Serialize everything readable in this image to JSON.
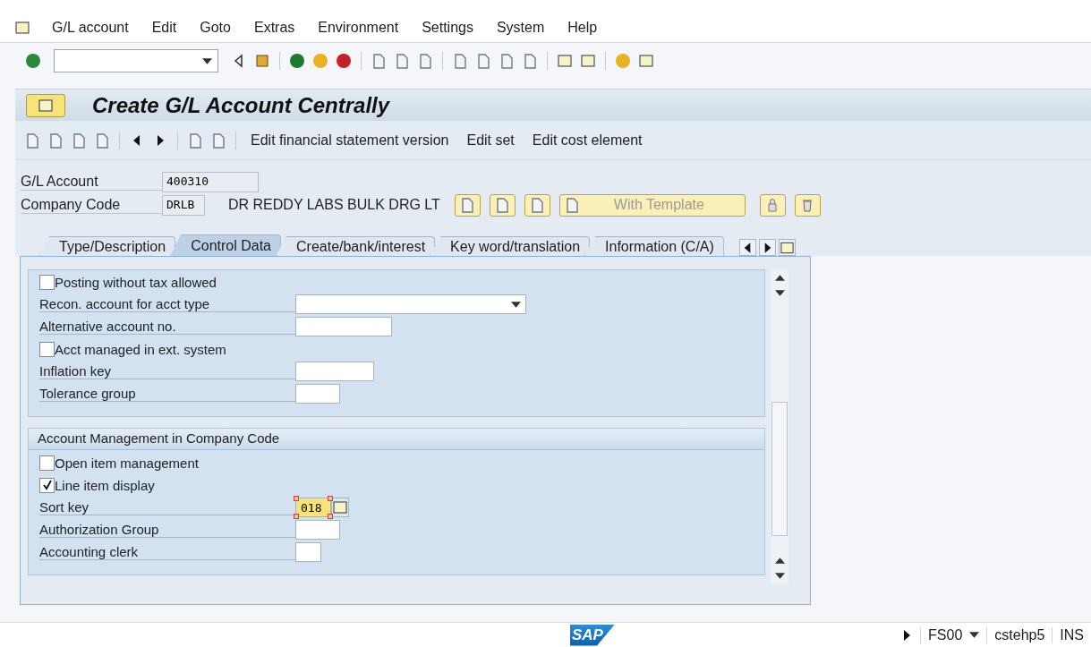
{
  "menu_bar": [
    "G/L account",
    "Edit",
    "Goto",
    "Extras",
    "Environment",
    "Settings",
    "System",
    "Help"
  ],
  "title": "Create G/L Account Centrally",
  "app_toolbar": [
    "Edit financial statement version",
    "Edit set",
    "Edit cost element"
  ],
  "header": {
    "fields": [
      {
        "label": "G/L Account",
        "value": "400310"
      },
      {
        "label": "Company Code",
        "value": "DRLB"
      }
    ],
    "company_name": "DR REDDY LABS BULK DRG LT",
    "template_button": "With Template"
  },
  "tabs": [
    {
      "label": "Type/Description",
      "selected": false
    },
    {
      "label": "Control Data",
      "selected": true
    },
    {
      "label": "Create/bank/interest",
      "selected": false
    },
    {
      "label": "Key word/translation",
      "selected": false
    },
    {
      "label": "Information (C/A)",
      "selected": false
    }
  ],
  "sections": [
    {
      "rows": [
        {
          "kind": "checkbox",
          "label": "Posting without tax allowed",
          "checked": false
        },
        {
          "kind": "dropdown",
          "label": "Recon. account for acct type"
        },
        {
          "kind": "input",
          "label": "Alternative account no."
        },
        {
          "kind": "checkbox",
          "label": "Acct managed in ext. system",
          "checked": false
        },
        {
          "kind": "input",
          "label": "Inflation key"
        },
        {
          "kind": "input",
          "label": "Tolerance group"
        }
      ]
    },
    {
      "title": "Account Management in Company Code",
      "rows": [
        {
          "kind": "checkbox",
          "label": "Open item management",
          "checked": false
        },
        {
          "kind": "checkbox",
          "label": "Line item display",
          "checked": true
        },
        {
          "kind": "input",
          "label": "Sort key",
          "value": "018",
          "focused": true
        },
        {
          "kind": "input",
          "label": "Authorization Group"
        },
        {
          "kind": "input",
          "label": "Accounting clerk"
        }
      ]
    }
  ],
  "status_bar": {
    "logo": "SAP",
    "transaction": "FS00",
    "system": "cstehp5",
    "mode": "INS"
  }
}
